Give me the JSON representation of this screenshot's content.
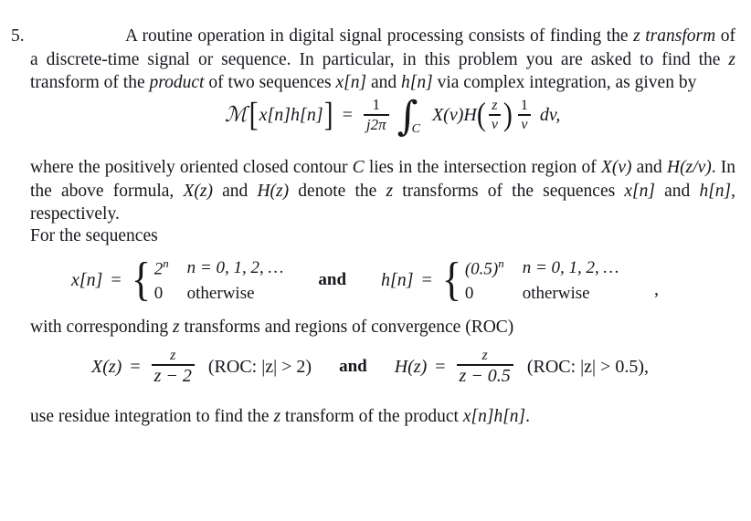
{
  "problem": {
    "number": "5.",
    "intro_paragraph": {
      "part1": "A routine operation in digital signal processing consists of finding the ",
      "emph_z": "z",
      "emph_transform": "transform",
      "part2": " of a discrete-time signal or sequence. In particular, in this problem you are asked to find the ",
      "z2": "z",
      "part3": " transform of the ",
      "emph_product": "product",
      "part4": " of two sequences ",
      "x_n": "x[n]",
      "part5": " and ",
      "h_n": "h[n]",
      "part6": " via complex integration, as given by"
    },
    "main_equation": {
      "operator": "ℳ",
      "operand": "x[n]h[n]",
      "equals": "=",
      "coef_num": "1",
      "coef_den": "j2π",
      "integral_sign": "∫",
      "contour": "C",
      "factor_X": "X(v)",
      "factor_H": "H",
      "h_arg_num": "z",
      "h_arg_den": "v",
      "tail_num": "1",
      "tail_den": "v",
      "differential": "dv,"
    },
    "where_paragraph": {
      "part1": "where the positively oriented closed contour ",
      "contour": "C",
      "part2": " lies in the intersection region of ",
      "Xv": "X(v)",
      "part3": " and ",
      "Hzv": "H(z/v)",
      "part4": ". In the above formula, ",
      "Xz": "X(z)",
      "part5": " and ",
      "Hz": "H(z)",
      "part6": " denote the ",
      "z": "z",
      "part7": " transforms of the sequences ",
      "x_n": "x[n]",
      "part8": " and ",
      "h_n": "h[n]",
      "part9": ", respectively."
    },
    "for_sequences_label": "For the sequences",
    "sequences": {
      "x": {
        "name": "x[n]",
        "equals": "=",
        "value1": "2",
        "value1_exp": "n",
        "cond1": "n = 0, 1, 2, …",
        "value2": "0",
        "cond2": "otherwise"
      },
      "and": "and",
      "h": {
        "name": "h[n]",
        "equals": "=",
        "value1": "(0.5)",
        "value1_exp": "n",
        "cond1": "n = 0, 1, 2, …",
        "value2": "0",
        "cond2": "otherwise"
      },
      "trailing_comma": ","
    },
    "with_corresponding_label": {
      "part1": "with corresponding ",
      "z": "z",
      "part2": " transforms and regions of convergence (ROC)"
    },
    "transforms": {
      "X": {
        "name": "X(z)",
        "equals": "=",
        "num": "z",
        "den": "z − 2",
        "roc": "(ROC: |z| > 2)"
      },
      "and": "and",
      "H": {
        "name": "H(z)",
        "equals": "=",
        "num": "z",
        "den": "z − 0.5",
        "roc": "(ROC: |z| > 0.5),"
      }
    },
    "closing_paragraph": {
      "part1": "use residue integration to find the ",
      "z": "z",
      "part2": " transform of the product ",
      "xh": "x[n]h[n]",
      "part3": "."
    }
  },
  "colors": {
    "background": "#ffffff",
    "text": "#15171c"
  }
}
